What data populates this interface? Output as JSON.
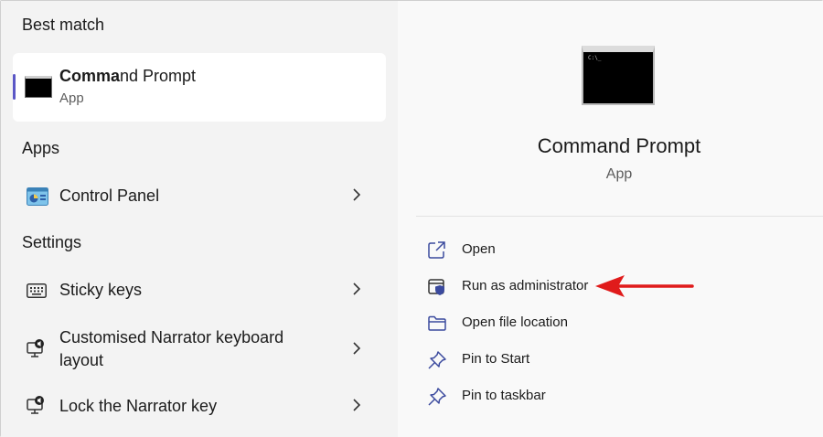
{
  "best_match": {
    "heading": "Best match",
    "name_bold": "Comma",
    "name_rest": "nd Prompt",
    "type": "App"
  },
  "apps": {
    "heading": "Apps",
    "items": [
      {
        "label": "Control Panel",
        "icon": "control-panel-icon"
      }
    ]
  },
  "settings": {
    "heading": "Settings",
    "items": [
      {
        "label": "Sticky keys",
        "icon": "keyboard-icon"
      },
      {
        "label": "Customised Narrator keyboard layout",
        "icon": "narrator-icon"
      },
      {
        "label": "Lock the Narrator key",
        "icon": "narrator-icon"
      }
    ]
  },
  "detail": {
    "title": "Command Prompt",
    "type": "App",
    "preview_text": "C:\\_"
  },
  "actions": [
    {
      "label": "Open",
      "icon": "open-external-icon"
    },
    {
      "label": "Run as administrator",
      "icon": "shield-admin-icon"
    },
    {
      "label": "Open file location",
      "icon": "folder-icon"
    },
    {
      "label": "Pin to Start",
      "icon": "pin-icon"
    },
    {
      "label": "Pin to taskbar",
      "icon": "pin-icon"
    }
  ],
  "colors": {
    "accent": "#5b57c6",
    "icon_blue": "#3b4a9e",
    "annotation_arrow": "#e01b1b"
  }
}
